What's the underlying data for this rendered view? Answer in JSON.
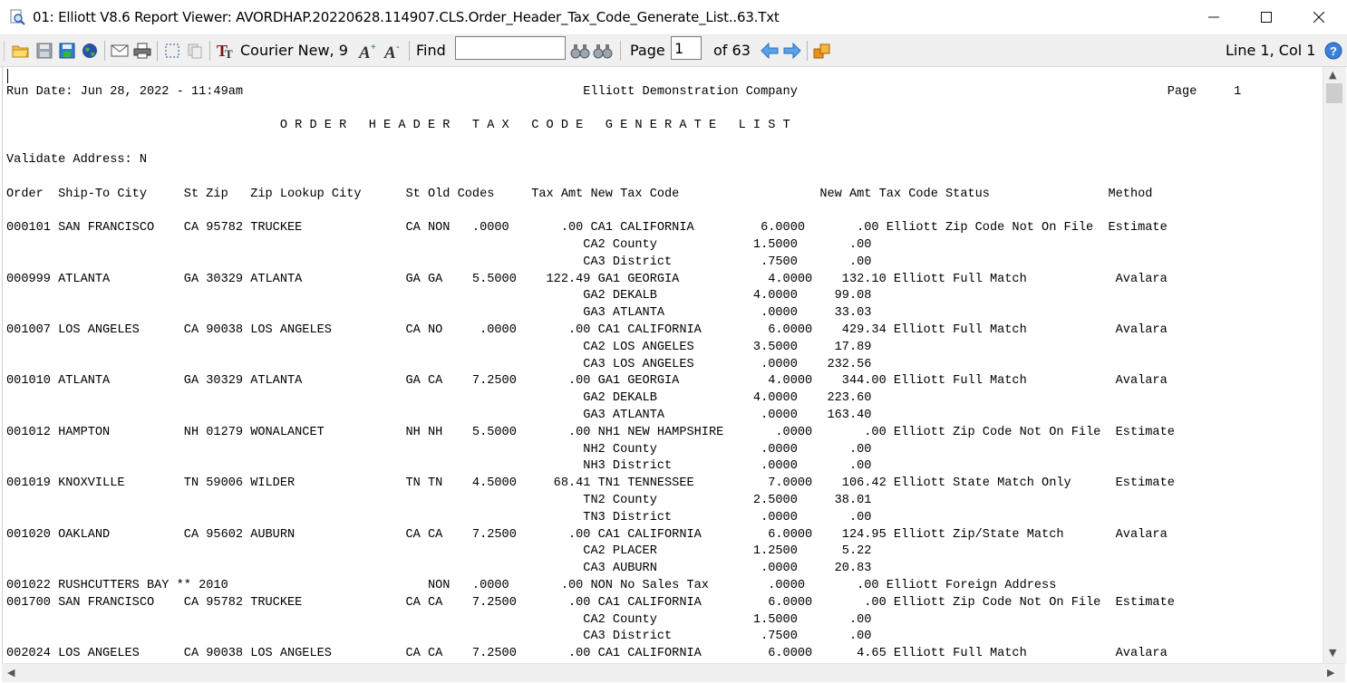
{
  "window": {
    "title": "01: Elliott V8.6 Report Viewer: AVORDHAP.20220628.114907.CLS.Order_Header_Tax_Code_Generate_List..63.Txt",
    "minimize_icon": "minimize-icon",
    "maximize_icon": "maximize-icon",
    "close_icon": "close-icon"
  },
  "toolbar": {
    "font_label": "Courier New, 9",
    "find_label": "Find",
    "find_value": "",
    "page_label": "Page",
    "page_value": "1",
    "of_pages": "of 63",
    "position": "Line 1, Col 1"
  },
  "report": {
    "lines": [
      "",
      "Run Date: Jun 28, 2022 - 11:49am                                              Elliott Demonstration Company                                                  Page     1",
      "",
      "                                     O R D E R   H E A D E R   T A X   C O D E   G E N E R A T E   L I S T",
      "",
      "Validate Address: N",
      "",
      "Order  Ship-To City     St Zip   Zip Lookup City      St Old Codes     Tax Amt New Tax Code                   New Amt Tax Code Status                Method",
      "",
      "000101 SAN FRANCISCO    CA 95782 TRUCKEE              CA NON   .0000       .00 CA1 CALIFORNIA         6.0000       .00 Elliott Zip Code Not On File  Estimate",
      "                                                                              CA2 County             1.5000       .00",
      "                                                                              CA3 District            .7500       .00",
      "000999 ATLANTA          GA 30329 ATLANTA              GA GA    5.5000    122.49 GA1 GEORGIA            4.0000    132.10 Elliott Full Match            Avalara",
      "                                                                              GA2 DEKALB             4.0000     99.08",
      "                                                                              GA3 ATLANTA             .0000     33.03",
      "001007 LOS ANGELES      CA 90038 LOS ANGELES          CA NO     .0000       .00 CA1 CALIFORNIA         6.0000    429.34 Elliott Full Match            Avalara",
      "                                                                              CA2 LOS ANGELES        3.5000     17.89",
      "                                                                              CA3 LOS ANGELES         .0000    232.56",
      "001010 ATLANTA          GA 30329 ATLANTA              GA CA    7.2500       .00 GA1 GEORGIA            4.0000    344.00 Elliott Full Match            Avalara",
      "                                                                              GA2 DEKALB             4.0000    223.60",
      "                                                                              GA3 ATLANTA             .0000    163.40",
      "001012 HAMPTON          NH 01279 WONALANCET           NH NH    5.5000       .00 NH1 NEW HAMPSHIRE       .0000       .00 Elliott Zip Code Not On File  Estimate",
      "                                                                              NH2 County              .0000       .00",
      "                                                                              NH3 District            .0000       .00",
      "001019 KNOXVILLE        TN 59006 WILDER               TN TN    4.5000     68.41 TN1 TENNESSEE          7.0000    106.42 Elliott State Match Only      Estimate",
      "                                                                              TN2 County             2.5000     38.01",
      "                                                                              TN3 District            .0000       .00",
      "001020 OAKLAND          CA 95602 AUBURN               CA CA    7.2500       .00 CA1 CALIFORNIA         6.0000    124.95 Elliott Zip/State Match       Avalara",
      "                                                                              CA2 PLACER             1.2500      5.22",
      "                                                                              CA3 AUBURN              .0000     20.83",
      "001022 RUSHCUTTERS BAY ** 2010                           NON   .0000       .00 NON No Sales Tax        .0000       .00 Elliott Foreign Address",
      "001700 SAN FRANCISCO    CA 95782 TRUCKEE              CA CA    7.2500       .00 CA1 CALIFORNIA         6.0000       .00 Elliott Zip Code Not On File  Estimate",
      "                                                                              CA2 County             1.5000       .00",
      "                                                                              CA3 District            .7500       .00",
      "002024 LOS ANGELES      CA 90038 LOS ANGELES          CA CA    7.2500       .00 CA1 CALIFORNIA         6.0000      4.65 Elliott Full Match            Avalara"
    ]
  }
}
